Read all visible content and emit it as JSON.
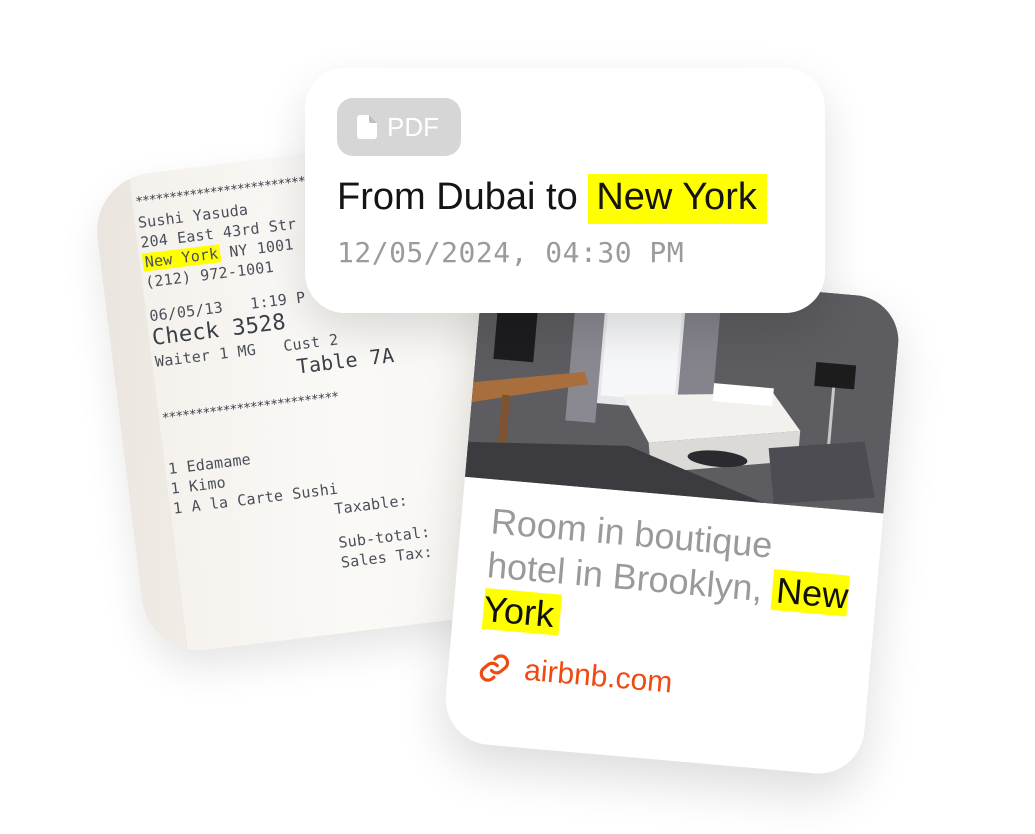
{
  "receipt": {
    "stars_line": "**************************",
    "restaurant": "Sushi Yasuda",
    "address_line": "204 East 43rd Str",
    "city": "New York",
    "state_zip": " NY 1001",
    "phone": "(212) 972-1001",
    "date": "06/05/13",
    "time": "1:19 P",
    "check": "Check 3528",
    "waiter": "Waiter 1 MG",
    "cust": "Cust 2",
    "table": "Table 7A",
    "items": [
      "1 Edamame",
      "1 Kimo",
      "1 A la Carte Sushi"
    ],
    "taxable": "Taxable:",
    "subtotal": "Sub-total:",
    "sales_tax": "Sales Tax:"
  },
  "pdf_card": {
    "badge_label": "PDF",
    "badge_icon": "document-icon",
    "title_prefix": "From Dubai to ",
    "title_highlight": "New York",
    "timestamp": "12/05/2024, 04:30 PM"
  },
  "hotel_card": {
    "title_text": "Room in boutique hotel in Brooklyn, ",
    "title_highlight": "New York",
    "link_icon": "link-icon",
    "link_text": "airbnb.com"
  },
  "colors": {
    "highlight": "#ffff00",
    "link": "#f04a12",
    "badge_bg": "#d6d6d6",
    "muted_text": "#9a9a9c"
  }
}
